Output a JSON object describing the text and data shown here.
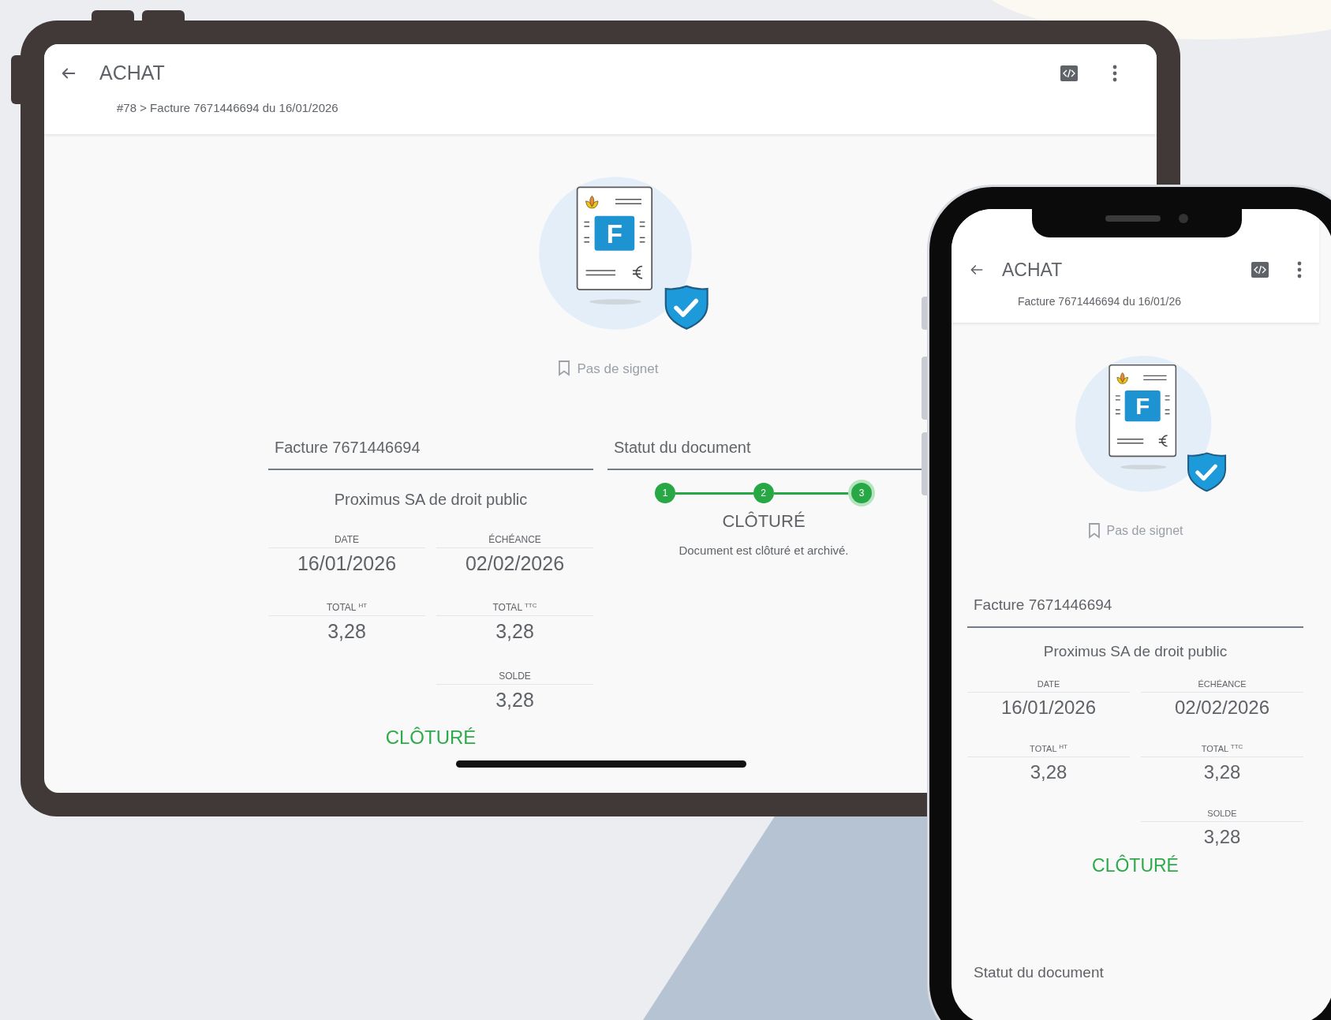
{
  "tablet": {
    "app_bar": {
      "title": "ACHAT",
      "subtitle": "#78 > Facture 7671446694 du 16/01/2026"
    },
    "illustration": {
      "letter": "F"
    },
    "bookmark": "Pas de signet",
    "invoice": {
      "title": "Facture 7671446694",
      "supplier": "Proximus SA de droit public",
      "fields": [
        {
          "label": "DATE",
          "value": "16/01/2026"
        },
        {
          "label": "ÉCHÉANCE",
          "value": "02/02/2026"
        },
        {
          "label": "TOTAL $^{HT}$",
          "value": "3,28"
        },
        {
          "label": "TOTAL $^{TTC}$",
          "value": "3,28"
        },
        {
          "label": "SOLDE",
          "value": "3,28"
        }
      ],
      "status": "CLÔTURÉ"
    },
    "document_status": {
      "title": "Statut du document",
      "steps": [
        {
          "label": "1",
          "selected": false
        },
        {
          "label": "2",
          "selected": false
        },
        {
          "label": "3",
          "selected": true
        }
      ],
      "status": "CLÔTURÉ",
      "description": "Document est clôturé et archivé."
    }
  },
  "phone": {
    "app_bar": {
      "title": "ACHAT",
      "subtitle": "Facture 7671446694 du 16/01/26"
    },
    "illustration": {
      "letter": "F"
    },
    "bookmark": "Pas de signet",
    "invoice": {
      "title": "Facture 7671446694",
      "supplier": "Proximus SA de droit public",
      "fields": [
        {
          "label": "DATE",
          "value": "16/01/2026"
        },
        {
          "label": "ÉCHÉANCE",
          "value": "02/02/2026"
        },
        {
          "label": "TOTAL $^{HT}$",
          "value": "3,28"
        },
        {
          "label": "TOTAL $^{TTC}$",
          "value": "3,28"
        },
        {
          "label": "SOLDE",
          "value": "3,28"
        }
      ],
      "status": "CLÔTURÉ"
    },
    "document_status": {
      "title": "Statut du document"
    }
  }
}
